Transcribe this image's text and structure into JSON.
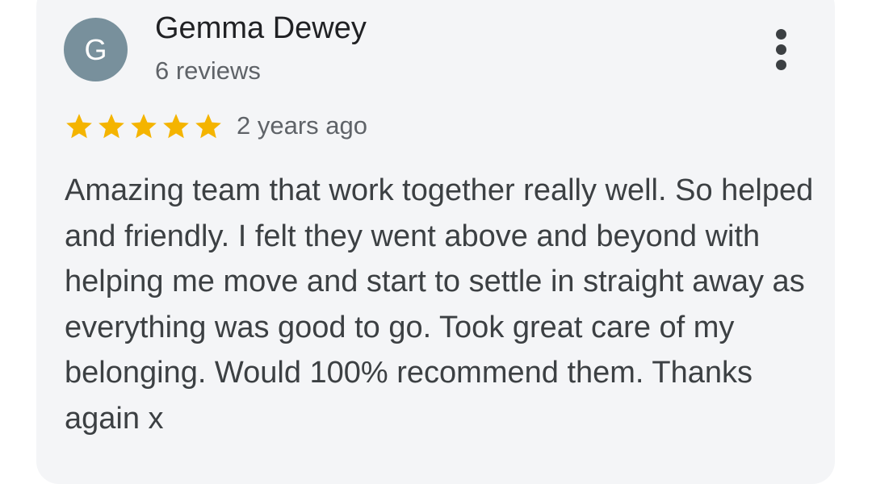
{
  "review": {
    "avatar_letter": "G",
    "author_name": "Gemma Dewey",
    "review_count": "6 reviews",
    "rating": 5,
    "rating_max": 5,
    "date": "2 years ago",
    "text": "Amazing team that work together really well. So helped and friendly. I felt they went above and beyond with helping me move and start to settle in straight away as everything was good to go. Took great care of my belonging. Would 100% recommend them. Thanks again x",
    "more_icon": "more-vert-icon"
  },
  "colors": {
    "card_background": "#f4f5f7",
    "avatar": "#78909c",
    "star": "#f4b400",
    "name_text": "#202124",
    "secondary_text": "#5f6368",
    "body_text": "#3c4043"
  }
}
